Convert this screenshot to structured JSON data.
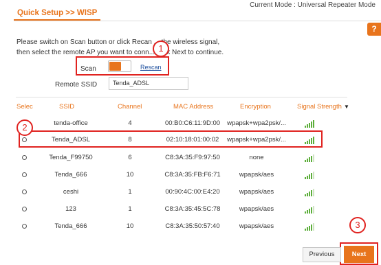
{
  "header": {
    "title": "Quick Setup >> WISP",
    "current_mode": "Current Mode : Universal Repeater Mode",
    "help_symbol": "?"
  },
  "instructions": {
    "line1": "Please switch on Scan button or click Recan ... the wireless signal,",
    "line2": "then select the remote AP you want to conn... click Next to continue."
  },
  "scan": {
    "label": "Scan",
    "enabled": true,
    "rescan_label": "Rescan"
  },
  "remote_ssid": {
    "label": "Remote SSID",
    "value": "Tenda_ADSL"
  },
  "table": {
    "headers": {
      "select": "Selec",
      "ssid": "SSID",
      "channel": "Channel",
      "mac": "MAC Address",
      "encryption": "Encryption",
      "signal": "Signal Strength",
      "sort_icon": "▼"
    },
    "rows": [
      {
        "ssid": "tenda-office",
        "channel": "4",
        "mac": "00:B0:C6:11:9D:00",
        "encryption": "wpapsk+wpa2psk/...",
        "signal_bars": 5
      },
      {
        "ssid": "Tenda_ADSL",
        "channel": "8",
        "mac": "02:10:18:01:00:02",
        "encryption": "wpapsk+wpa2psk/...",
        "signal_bars": 5
      },
      {
        "ssid": "Tenda_F99750",
        "channel": "6",
        "mac": "C8:3A:35:F9:97:50",
        "encryption": "none",
        "signal_bars": 4
      },
      {
        "ssid": "Tenda_666",
        "channel": "10",
        "mac": "C8:3A:35:FB:F6:71",
        "encryption": "wpapsk/aes",
        "signal_bars": 4
      },
      {
        "ssid": "ceshi",
        "channel": "1",
        "mac": "00:90:4C:00:E4:20",
        "encryption": "wpapsk/aes",
        "signal_bars": 4
      },
      {
        "ssid": "123",
        "channel": "1",
        "mac": "C8:3A:35:45:5C:78",
        "encryption": "wpapsk/aes",
        "signal_bars": 4
      },
      {
        "ssid": "Tenda_666",
        "channel": "10",
        "mac": "C8:3A:35:50:57:40",
        "encryption": "wpapsk/aes",
        "signal_bars": 4
      }
    ]
  },
  "annotations": {
    "callout1": "1",
    "callout2": "2",
    "callout3": "3"
  },
  "buttons": {
    "previous": "Previous",
    "next": "Next"
  },
  "colors": {
    "accent": "#e8741c",
    "annotation_red": "#e0221f",
    "signal_green": "#5cae3a",
    "link_blue": "#1a4c9c"
  }
}
